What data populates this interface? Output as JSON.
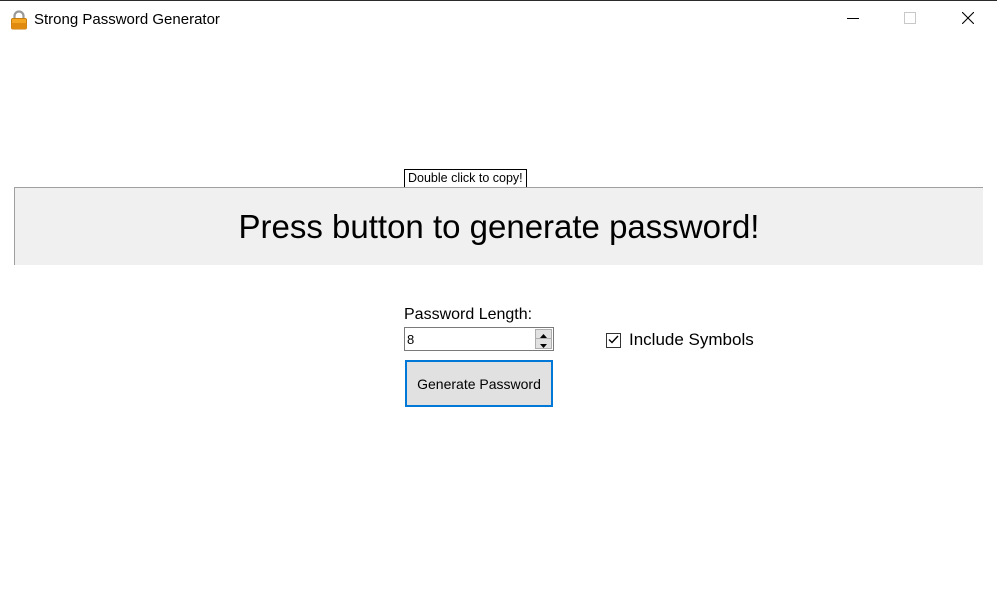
{
  "window": {
    "title": "Strong Password Generator",
    "icon": "lock-icon",
    "controls": {
      "minimize": "minimize-icon",
      "maximize": "maximize-icon",
      "close": "close-icon"
    }
  },
  "main": {
    "copy_hint": "Double click to copy!",
    "password_display": "Press button to generate password!",
    "length_label": "Password Length:",
    "length_value": "8",
    "include_symbols_label": "Include Symbols",
    "include_symbols_checked": true,
    "generate_button_label": "Generate Password"
  },
  "colors": {
    "accent": "#0078d7",
    "display_background": "#f0f0f0",
    "button_background": "#e1e1e1",
    "lock_body": "#f4a623"
  }
}
